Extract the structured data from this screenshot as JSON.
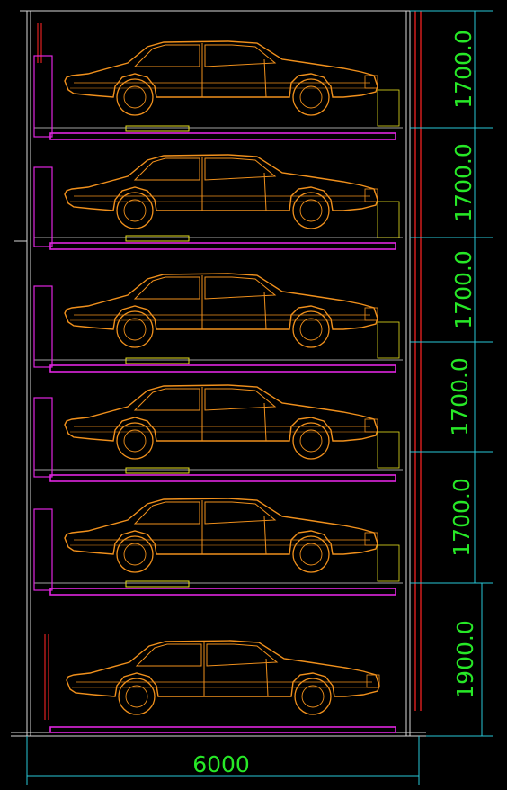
{
  "dimensions": {
    "levels": [
      "1700.0",
      "1700.0",
      "1700.0",
      "1700.0",
      "1700.0",
      "1900.0"
    ],
    "total_width": "6000"
  },
  "colors": {
    "car": "#f0901c",
    "pallet": "#e026e0",
    "frame": "#d8d8d8",
    "dimension": "#27e827",
    "dimension_line": "#27c8d8",
    "mechanism": "#e8e020",
    "accent_red": "#e02020",
    "background": "#000000"
  }
}
